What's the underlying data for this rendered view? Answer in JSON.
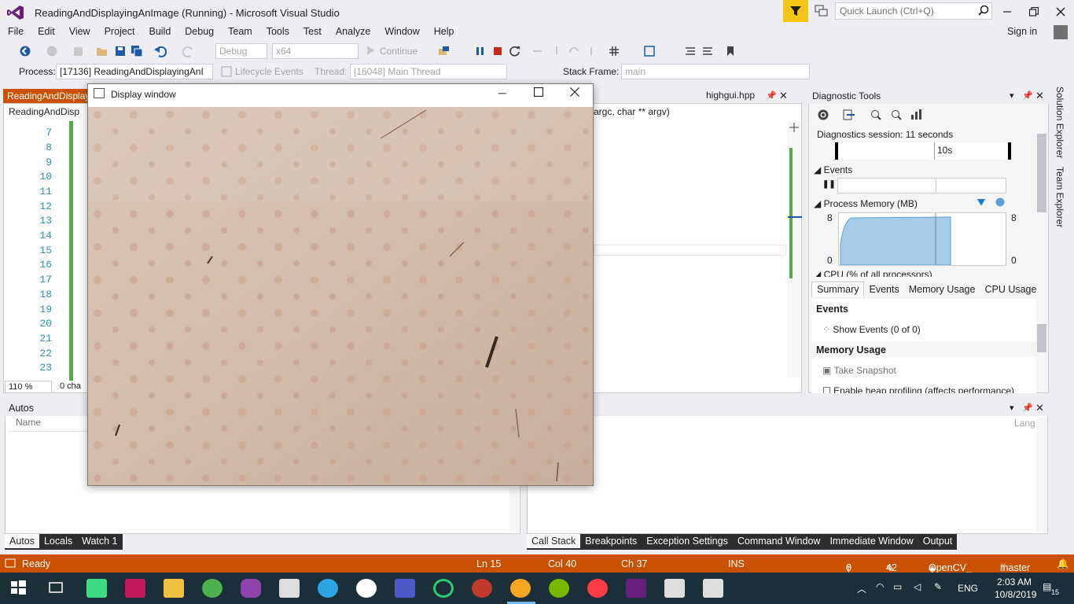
{
  "window": {
    "title": "ReadingAndDisplayingAnImage (Running) - Microsoft Visual Studio",
    "quick_launch_placeholder": "Quick Launch (Ctrl+Q)",
    "signin": "Sign in"
  },
  "menu": [
    "File",
    "Edit",
    "View",
    "Project",
    "Build",
    "Debug",
    "Team",
    "Tools",
    "Test",
    "Analyze",
    "Window",
    "Help"
  ],
  "toolbar": {
    "config": "Debug",
    "platform": "x64",
    "continue_label": "Continue",
    "process_label": "Process:",
    "process_value": "[17136] ReadingAndDisplayingAnI",
    "lifecycle_label": "Lifecycle Events",
    "thread_label": "Thread:",
    "thread_value": "[16048] Main Thread",
    "stackframe_label": "Stack Frame:",
    "stackframe_value": "main"
  },
  "editor": {
    "active_tab": "ReadingAndDisplay",
    "second_tab": "highgui.hpp",
    "nav_left": "ReadingAndDisp",
    "nav_right": "argc, char ** argv)",
    "line_numbers": [
      "7",
      "8",
      "9",
      "10",
      "11",
      "12",
      "13",
      "14",
      "15",
      "16",
      "17",
      "18",
      "19",
      "20",
      "21",
      "22",
      "23"
    ],
    "zoom": "110 %",
    "chars": "0 cha"
  },
  "display_window": {
    "title": "Display window"
  },
  "diagnostics": {
    "header": "Diagnostic Tools",
    "session": "Diagnostics session: 11 seconds",
    "timeline_tick": "10s",
    "events_label": "Events",
    "process_memory_label": "Process Memory (MB)",
    "mem_max_left": "8",
    "mem_min_left": "0",
    "mem_max_right": "8",
    "mem_min_right": "0",
    "cpu_label": "CPU (% of all processors)",
    "tabs": [
      "Summary",
      "Events",
      "Memory Usage",
      "CPU Usage"
    ],
    "events_section": "Events",
    "show_events": "Show Events (0 of 0)",
    "memory_section": "Memory Usage",
    "take_snapshot": "Take Snapshot",
    "heap_profiling": "Enable heap profiling (affects performance)"
  },
  "side_strip": [
    "Solution Explorer",
    "Team Explorer"
  ],
  "autos": {
    "header": "Autos",
    "col_name": "Name",
    "tabs": [
      "Autos",
      "Locals",
      "Watch 1"
    ]
  },
  "right_panel": {
    "col_lang": "Lang",
    "tabs": [
      "Call Stack",
      "Breakpoints",
      "Exception Settings",
      "Command Window",
      "Immediate Window",
      "Output"
    ]
  },
  "status": {
    "ready": "Ready",
    "ln": "Ln 15",
    "col": "Col 40",
    "ch": "Ch 37",
    "ins": "INS",
    "up_count": "0",
    "edit_count": "42",
    "repo": "OpenCV_",
    "branch": "master"
  },
  "taskbar": {
    "time": "2:03 AM",
    "date": "10/8/2019",
    "lang": "ENG",
    "notif_count": "15"
  },
  "colors": {
    "accent_orange": "#ca5100",
    "vs_purple": "#68217a",
    "taskbar_bg": "#1a2f38"
  }
}
